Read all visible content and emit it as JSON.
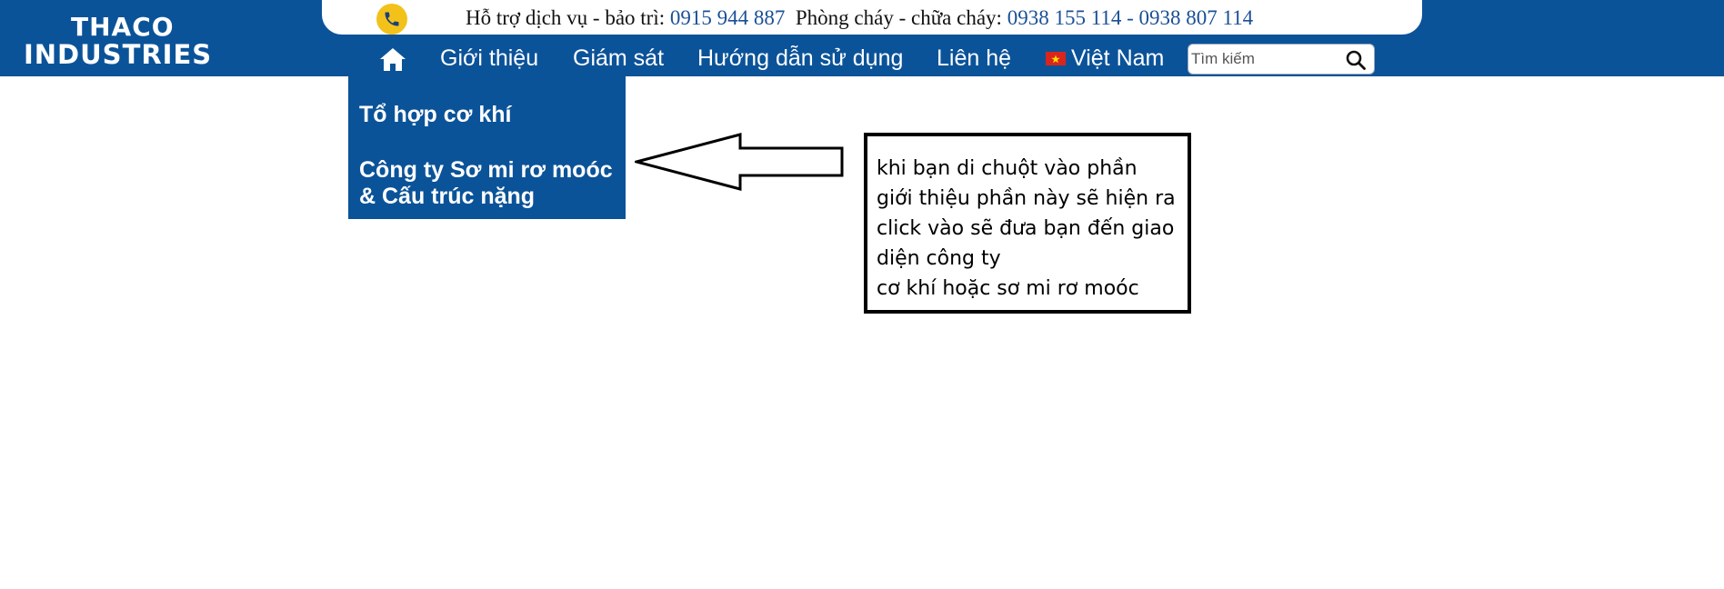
{
  "brand": {
    "line1": "THACO",
    "line2": "INDUSTRIES"
  },
  "hotline": {
    "icon": "phone-icon",
    "service_label": "Hỗ trợ dịch vụ - bảo trì:",
    "service_number": "0915 944 887",
    "fire_label": "Phòng cháy - chữa cháy:",
    "fire_numbers": "0938 155 114 - 0938 807 114"
  },
  "nav": {
    "home_icon": "home-icon",
    "items": [
      "Giới thiệu",
      "Giám sát",
      "Hướng dẫn sử dụng",
      "Liên hệ"
    ],
    "language": "Việt Nam"
  },
  "search": {
    "placeholder": "Tìm kiếm",
    "icon": "search-icon"
  },
  "dropdown": {
    "items": [
      "Tổ hợp cơ khí",
      "Công ty Sơ mi rơ moóc",
      "& Cấu trúc nặng"
    ]
  },
  "annotation": {
    "lines": [
      "khi bạn di chuột vào phần",
      "giới thiệu phần này sẽ hiện ra",
      "click vào sẽ đưa bạn đến giao",
      "diện công ty",
      "cơ khí hoặc sơ mi rơ moóc"
    ]
  },
  "colors": {
    "brand_blue": "#0b5399",
    "hotline_number": "#1a4f96",
    "phone_badge": "#f2c21b"
  }
}
